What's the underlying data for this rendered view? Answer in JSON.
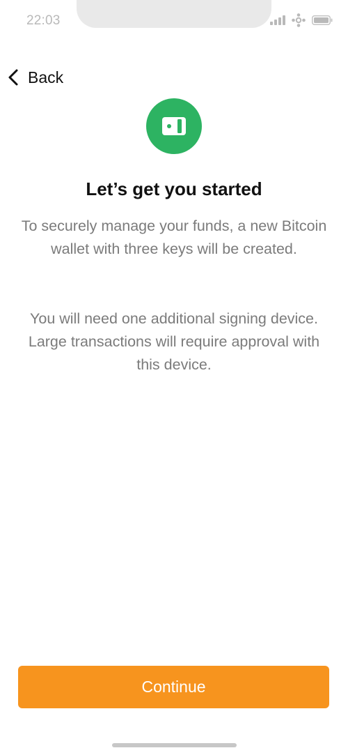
{
  "status_bar": {
    "time": "22:03",
    "icons": [
      "signal-icon",
      "network-icon",
      "battery-icon"
    ]
  },
  "nav": {
    "back_label": "Back",
    "back_icon": "chevron-left-icon"
  },
  "hero": {
    "icon": "hardware-wallet-icon",
    "icon_bg_color": "#2db362"
  },
  "content": {
    "title": "Let’s get you started",
    "paragraph_1": "To securely manage your funds, a new Bitcoin wallet with three keys will be created.",
    "paragraph_2": "You will need one additional signing device. Large transactions will require approval with this device."
  },
  "footer": {
    "continue_label": "Continue",
    "button_color": "#f7941e"
  }
}
